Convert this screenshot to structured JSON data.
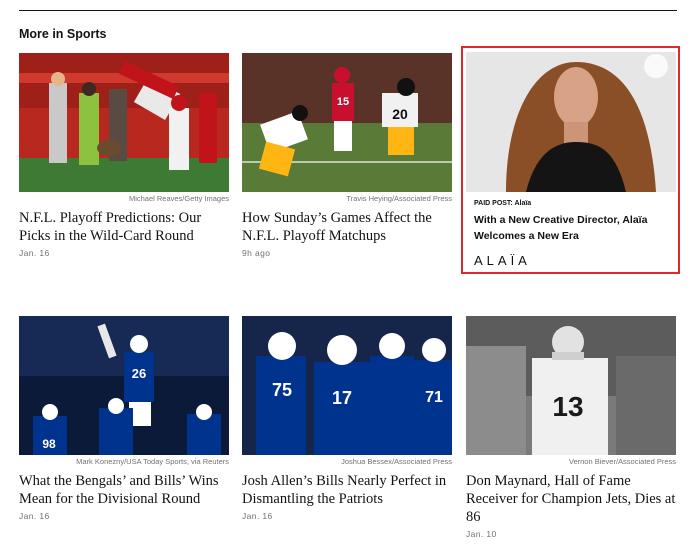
{
  "section": {
    "title": "More in Sports"
  },
  "cards": [
    {
      "credit": "Michael Reaves/Getty Images",
      "headline": "N.F.L. Playoff Predictions: Our Picks in the Wild-Card Round",
      "date": "Jan. 16"
    },
    {
      "credit": "Travis Heying/Associated Press",
      "headline": "How Sunday’s Games Affect the N.F.L. Playoff Matchups",
      "date": "9h ago"
    },
    {
      "credit": "Mark Konezny/USA Today Sports, via Reuters",
      "headline": "What the Bengals’ and Bills’ Wins Mean for the Divisional Round",
      "date": "Jan. 16"
    },
    {
      "credit": "Joshua Bessex/Associated Press",
      "headline": "Josh Allen’s Bills Nearly Perfect in Dismantling the Patriots",
      "date": "Jan. 16"
    },
    {
      "credit": "Vernon Biever/Associated Press",
      "headline": "Don Maynard, Hall of Fame Receiver for Champion Jets, Dies at 86",
      "date": "Jan. 10"
    }
  ],
  "ad": {
    "label": "PAID POST: Alaïa",
    "headline": "With a New Creative Director, Alaïa Welcomes a New Era",
    "logo": "ALAÏA"
  },
  "jerseys": {
    "chiefs_qb": "15",
    "steelers_player": "20",
    "bills_a": "26",
    "bills_b": "98",
    "bills_c": "75",
    "bills_d": "17",
    "bills_e": "71",
    "jets_player": "13"
  }
}
